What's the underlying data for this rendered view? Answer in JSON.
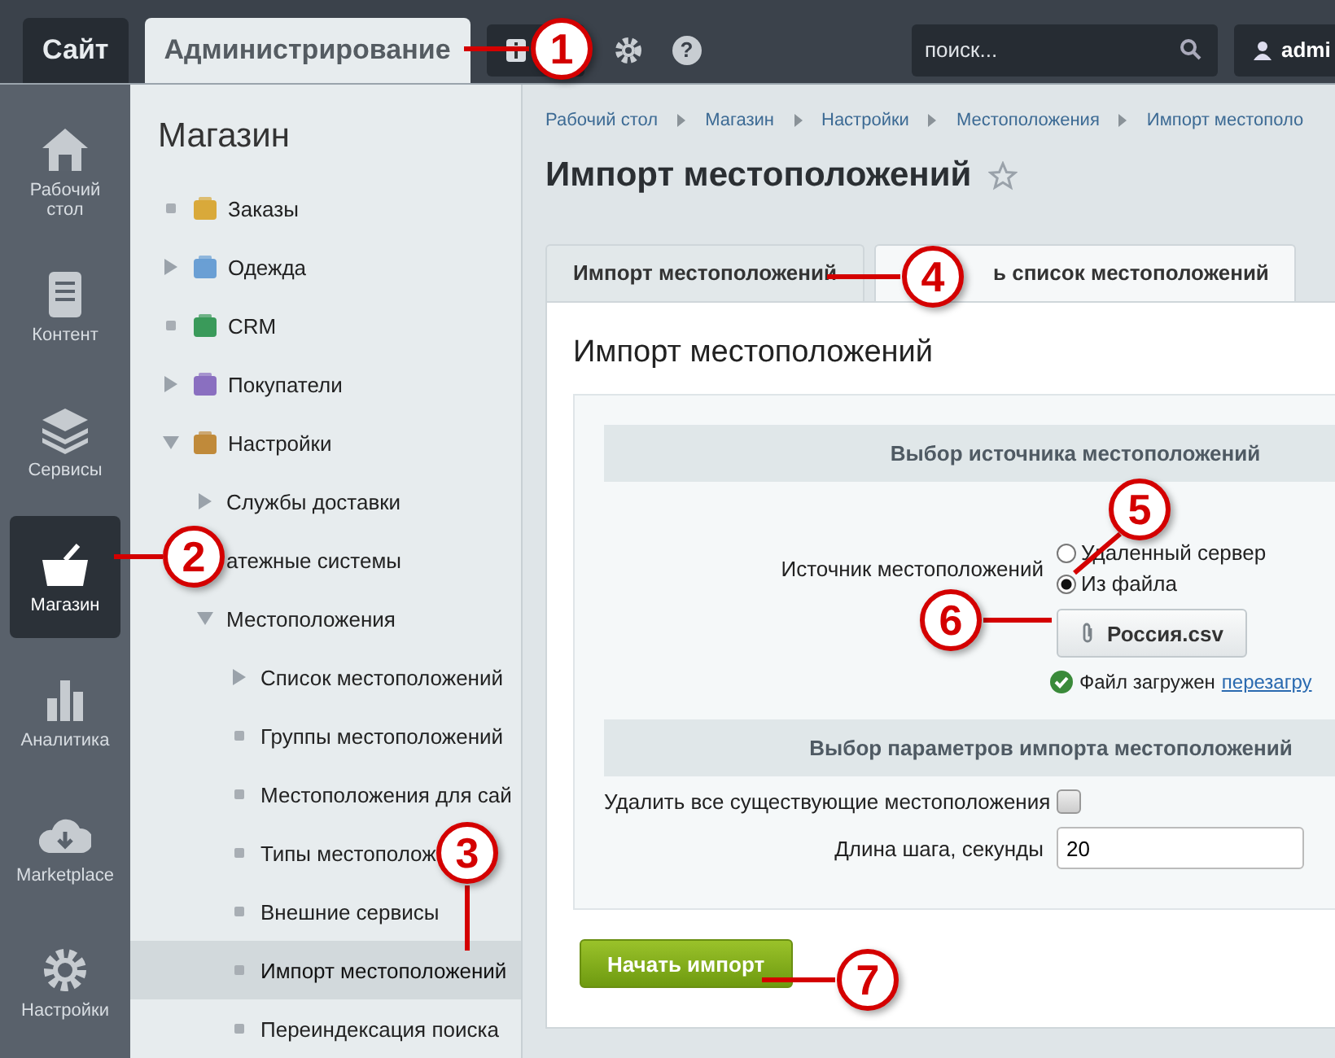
{
  "top_bar": {
    "tabs": [
      {
        "label": "Сайт",
        "selected": false
      },
      {
        "label": "Администрирование",
        "selected": true
      }
    ],
    "search": {
      "placeholder": "поиск..."
    },
    "help_icon": "?",
    "user": {
      "name": "admi"
    }
  },
  "sidebar": {
    "items": [
      {
        "label": "Рабочий стол",
        "selected": false
      },
      {
        "label": "Контент",
        "selected": false
      },
      {
        "label": "Сервисы",
        "selected": false
      },
      {
        "label": "Магазин",
        "selected": true
      },
      {
        "label": "Аналитика",
        "selected": false
      },
      {
        "label": "Marketplace",
        "selected": false
      },
      {
        "label": "Настройки",
        "selected": false
      }
    ]
  },
  "menu": {
    "title": "Магазин",
    "items": [
      {
        "label": "Заказы",
        "kind": "leaf",
        "selected": false
      },
      {
        "label": "Одежда",
        "kind": "folder",
        "expanded": false,
        "selected": false
      },
      {
        "label": "CRM",
        "kind": "leaf",
        "selected": false
      },
      {
        "label": "Покупатели",
        "kind": "folder",
        "expanded": false,
        "selected": false
      },
      {
        "label": "Настройки",
        "kind": "folder",
        "expanded": true,
        "selected": false,
        "children": [
          {
            "label": "Службы доставки",
            "kind": "folder",
            "expanded": false,
            "selected": false
          },
          {
            "label": "атежные системы",
            "selected": false
          },
          {
            "label": "Местоположения",
            "kind": "folder",
            "expanded": true,
            "selected": false,
            "children": [
              {
                "label": "Список местоположений",
                "kind": "folder",
                "expanded": false,
                "selected": false
              },
              {
                "label": "Группы местоположений",
                "kind": "leaf",
                "selected": false
              },
              {
                "label": "Местоположения для сай",
                "kind": "leaf",
                "selected": false
              },
              {
                "label": "Типы местополож",
                "kind": "leaf",
                "selected": false
              },
              {
                "label": "Внешние сервисы",
                "kind": "leaf",
                "selected": false
              },
              {
                "label": "Импорт местоположений",
                "kind": "leaf",
                "selected": true
              },
              {
                "label": "Переиндексация поиска",
                "kind": "leaf",
                "selected": false
              }
            ]
          }
        ]
      }
    ]
  },
  "breadcrumbs": [
    "Рабочий стол",
    "Магазин",
    "Настройки",
    "Местоположения",
    "Импорт местополо"
  ],
  "page_title": "Импорт местоположений",
  "tabs": [
    {
      "label": "Импорт местоположений",
      "selected": true
    },
    {
      "label": "ь список местоположений",
      "selected": false
    }
  ],
  "form": {
    "heading": "Импорт местоположений",
    "source_section": {
      "title": "Выбор источника местоположений",
      "label": "Источник местоположений",
      "options": [
        {
          "label": "Удаленный сервер",
          "selected": false
        },
        {
          "label": "Из файла",
          "selected": true
        }
      ],
      "file_button": "Россия.csv",
      "status": "Файл загружен",
      "reload_link": "перезагру"
    },
    "params_section": {
      "title": "Выбор параметров импорта местоположений",
      "delete_all": {
        "label": "Удалить все существующие местоположения",
        "checked": false
      },
      "step": {
        "label": "Длина шага, секунды",
        "value": "20"
      }
    },
    "submit": "Начать импорт"
  },
  "callouts": [
    "1",
    "2",
    "3",
    "4",
    "5",
    "6",
    "7"
  ]
}
